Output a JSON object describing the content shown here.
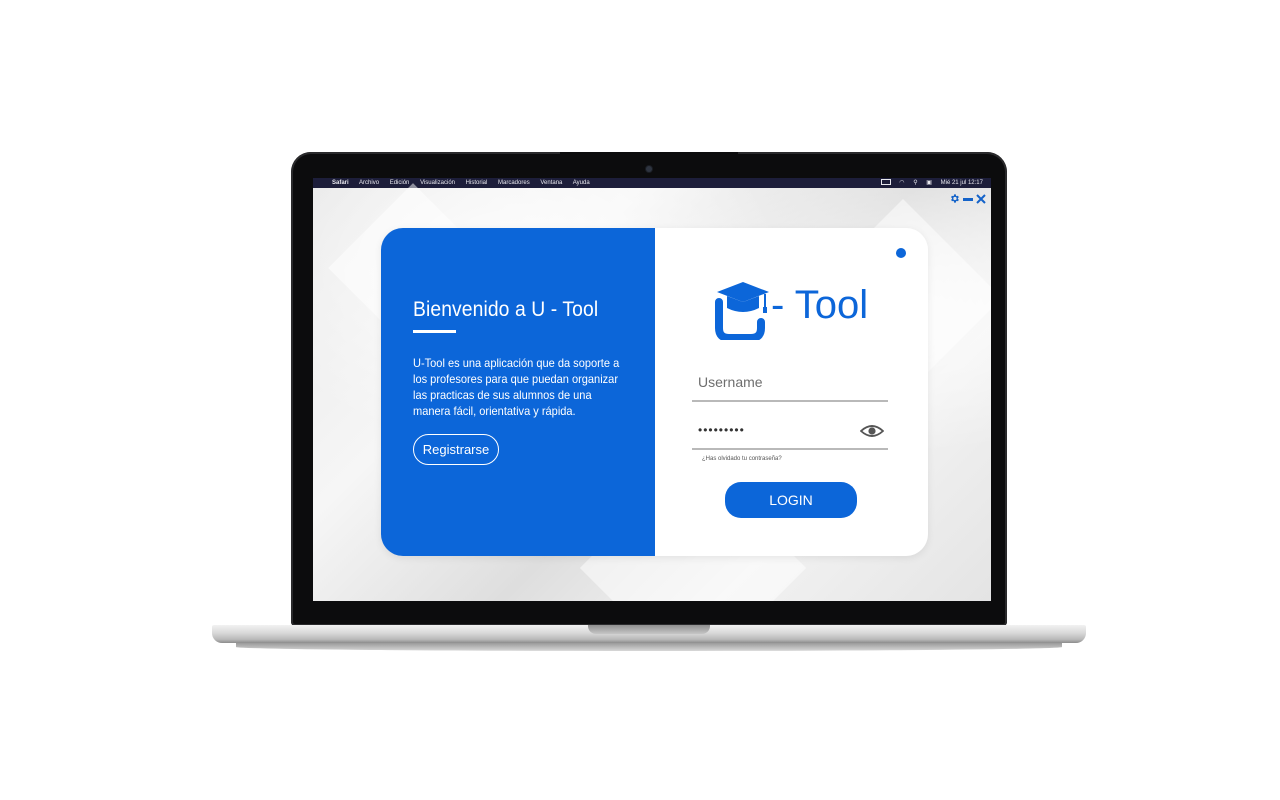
{
  "menubar": {
    "apple_icon": "apple-icon",
    "items": [
      "Safari",
      "Archivo",
      "Edición",
      "Visualización",
      "Historial",
      "Marcadores",
      "Ventana",
      "Ayuda"
    ],
    "datetime": "Mié 21 jul  12:17"
  },
  "window_controls": {
    "settings_icon": "gear-icon",
    "minimize_icon": "minimize-icon",
    "close_icon": "close-icon"
  },
  "welcome_panel": {
    "title": "Bienvenido a U - Tool",
    "description": "U-Tool es una aplicación que da soporte a los profesores para que puedan organizar las practicas de sus alumnos de una manera fácil, orientativa y rápida.",
    "register_label": "Registrarse"
  },
  "login_panel": {
    "logo_text": "- Tool",
    "username_placeholder": "Username",
    "password_value": "•••••••••",
    "forgot_label": "¿Has olvidado tu contraseña?",
    "login_label": "LOGIN"
  },
  "colors": {
    "brand_blue": "#0c66d9",
    "menubar": "#1d1e3a"
  }
}
